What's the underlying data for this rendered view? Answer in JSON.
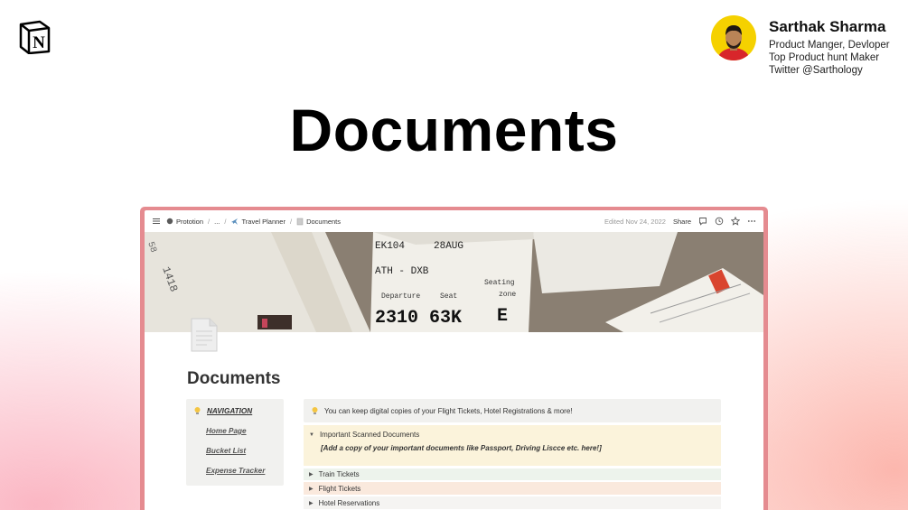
{
  "author": {
    "name": "Sarthak Sharma",
    "lines": [
      "Product Manger, Devloper",
      "Top Product hunt Maker",
      "Twitter @Sarthology"
    ]
  },
  "hero": {
    "title": "Documents"
  },
  "notion": {
    "breadcrumbs": [
      "Prototion",
      "...",
      "Travel Planner",
      "Documents"
    ],
    "edited": "Edited Nov 24, 2022",
    "share_label": "Share",
    "cover_text": {
      "flight_no": "EK104",
      "date": "28AUG",
      "route": "ATH - DXB",
      "seating": "Seating",
      "zone": "zone",
      "departure": "Departure",
      "seat": "Seat",
      "numbers": "2310 63K",
      "letter": "E",
      "left_numbers": "1418",
      "left_small": "58"
    },
    "page_title": "Documents",
    "nav": {
      "heading": "NAVIGATION",
      "links": [
        "Home Page",
        "Bucket List",
        "Expense Tracker"
      ]
    },
    "callout_text": "You can keep digital copies of your Flight Tickets, Hotel Registrations & more!",
    "toggles": [
      {
        "label": "Important Scanned Documents",
        "note": "[Add a copy of your important documents like Passport, Driving Liscce etc. here!]"
      },
      {
        "label": "Train Tickets"
      },
      {
        "label": "Flight Tickets"
      },
      {
        "label": "Hotel Reservations"
      }
    ]
  }
}
